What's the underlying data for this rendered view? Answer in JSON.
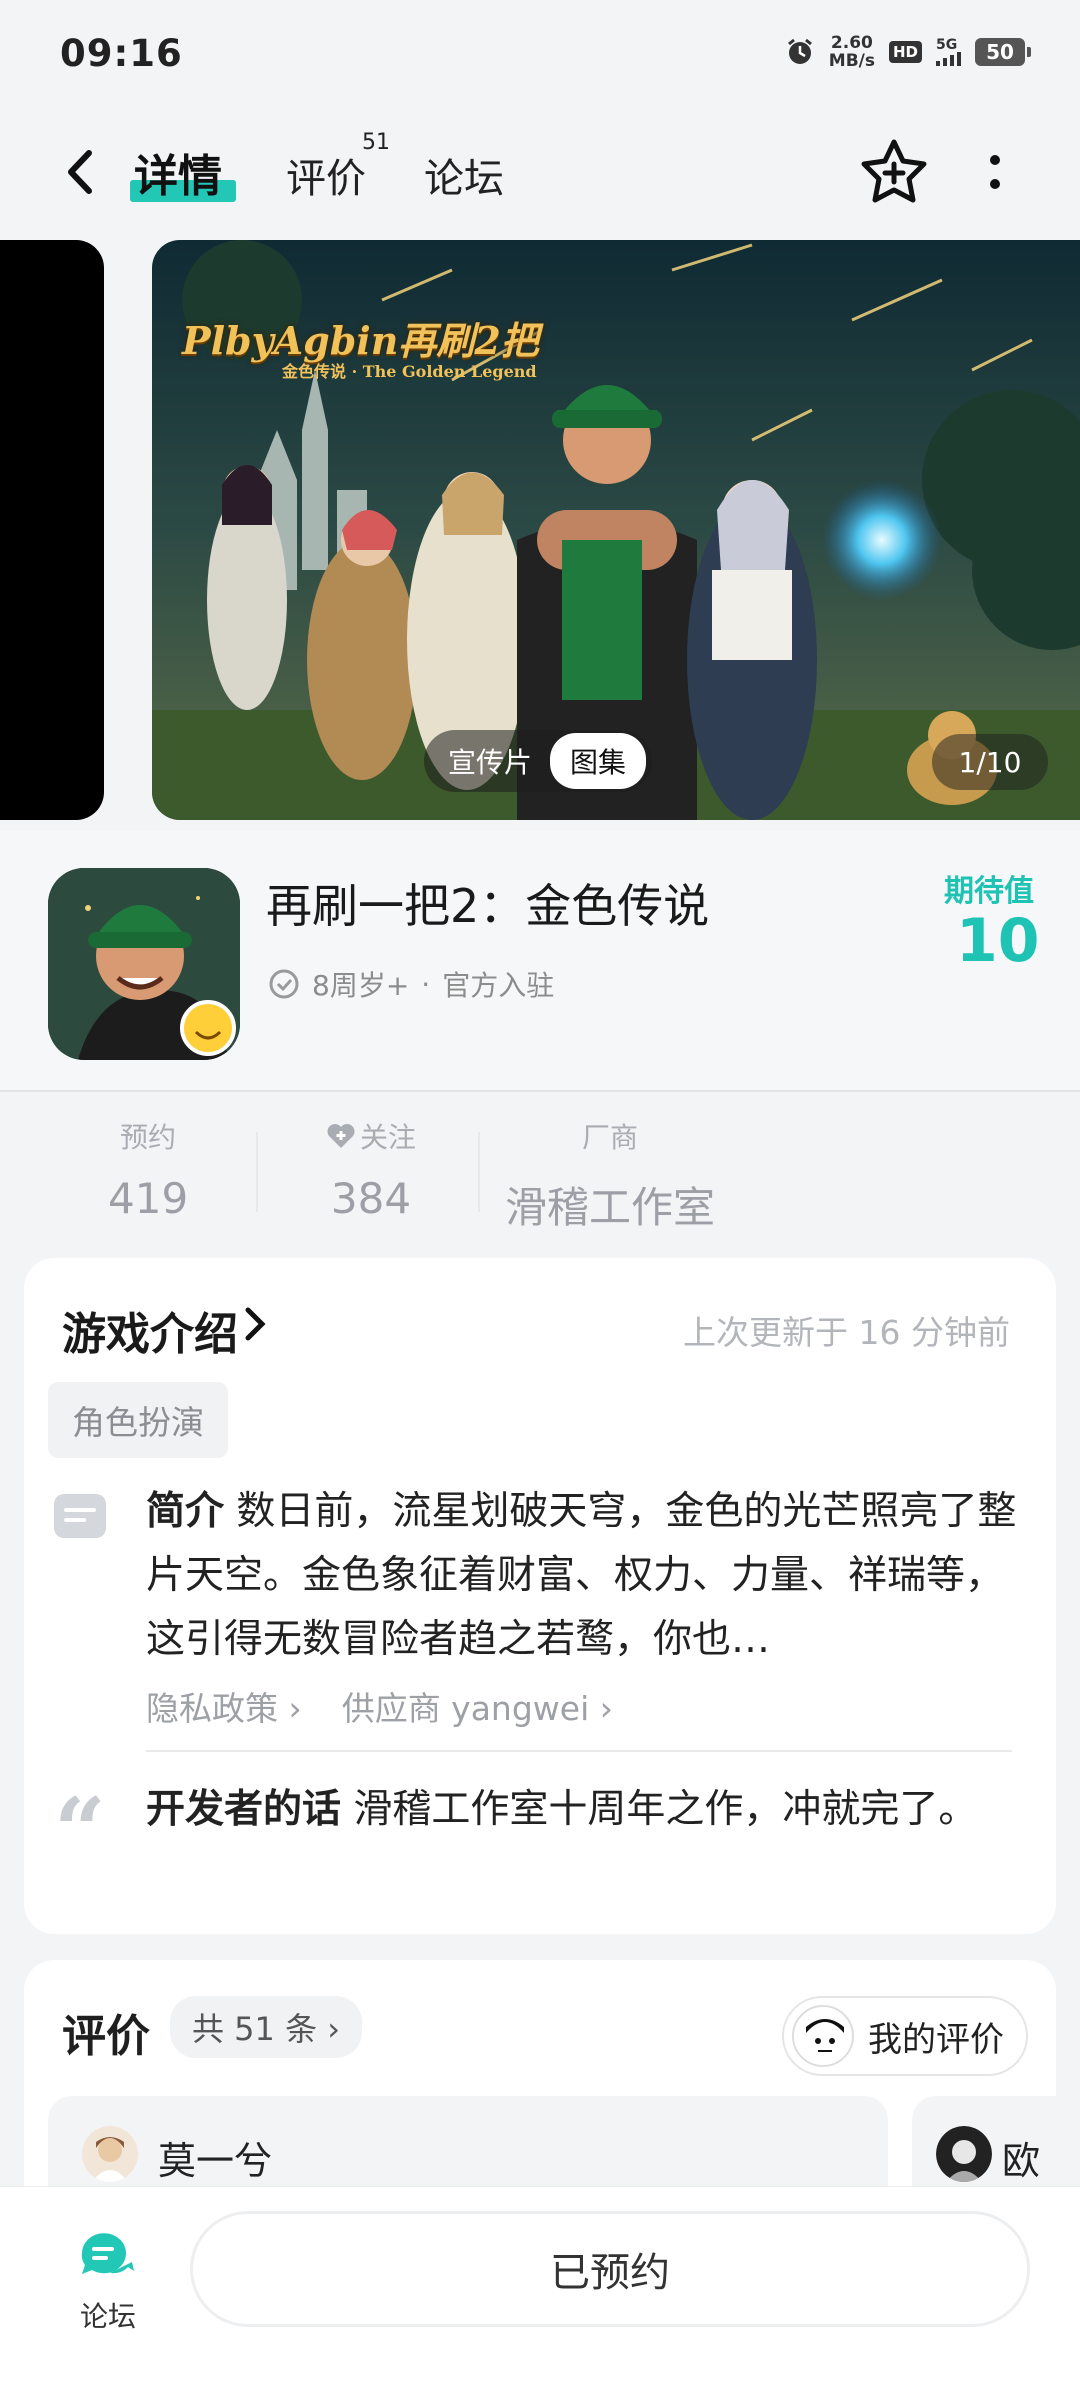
{
  "status_bar": {
    "time": "09:16",
    "net_speed_value": "2.60",
    "net_speed_unit": "MB/s",
    "hd_label": "HD",
    "network_label": "5G",
    "battery": "50"
  },
  "nav": {
    "tabs": [
      {
        "label": "详情",
        "active": true
      },
      {
        "label": "评价",
        "badge": "51"
      },
      {
        "label": "论坛"
      }
    ]
  },
  "hero": {
    "logo_text": "PlbyAgbin再刷2把",
    "logo_sub": "金色传说 · The Golden Legend",
    "toggle": [
      "宣传片",
      "图集"
    ],
    "counter": "1/10"
  },
  "app": {
    "title": "再刷一把2：金色传说",
    "age_rating": "8周岁+",
    "separator": "·",
    "official": "官方入驻",
    "expect_label": "期待值",
    "expect_value": "10"
  },
  "stats": [
    {
      "label": "预约",
      "value": "419"
    },
    {
      "label": "关注",
      "value": "384"
    },
    {
      "label": "厂商",
      "value": "滑稽工作室"
    }
  ],
  "intro": {
    "title": "游戏介绍",
    "updated": "上次更新于 16 分钟前",
    "tag": "角色扮演",
    "desc_label": "简介",
    "desc_text": "数日前，流星划破天穹，金色的光芒照亮了整片天空。金色象征着财富、权力、力量、祥瑞等，这引得无数冒险者趋之若鹜，你也…",
    "privacy": "隐私政策 ›",
    "supplier": "供应商 yangwei ›",
    "dev_label": "开发者的话",
    "dev_text": "滑稽工作室十周年之作，冲就完了。"
  },
  "reviews": {
    "title": "评价",
    "count": "共 51 条 ›",
    "my_review": "我的评价",
    "items": [
      {
        "name": "莫一兮"
      },
      {
        "name": "欧"
      }
    ]
  },
  "bottom": {
    "forum_label": "论坛",
    "reserve_label": "已预约"
  },
  "colors": {
    "accent": "#22c7b6",
    "expect": "#1ec3b4"
  }
}
